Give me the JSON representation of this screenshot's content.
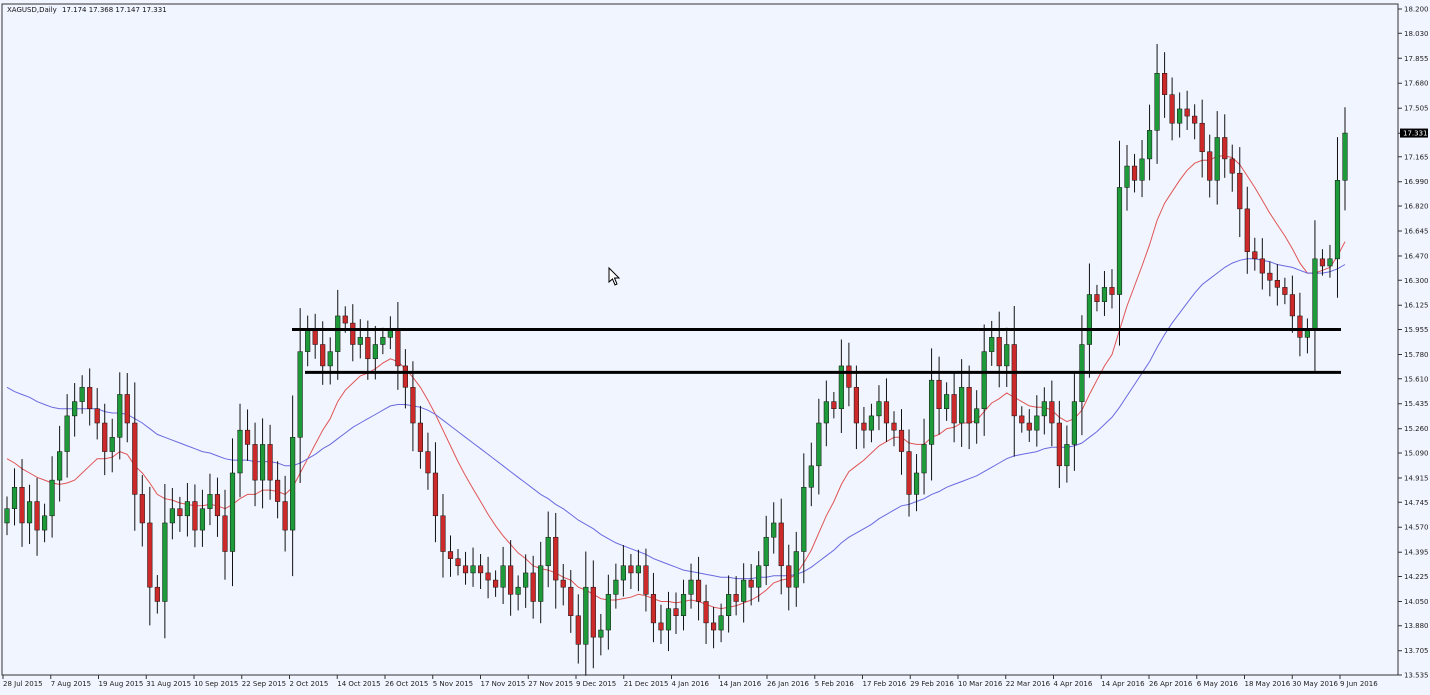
{
  "window": {
    "symbol": "XAGUSD,Daily",
    "ohlc_header": "17.174 17.368 17.147 17.331"
  },
  "colors": {
    "background": "#f1f5ff",
    "bull": "#1f9a3a",
    "bear": "#cc2a2a",
    "ma_fast": "#e05555",
    "ma_slow": "#6a6ae0",
    "support_lines": "#000000",
    "price_label_bg": "#000000"
  },
  "chart_data": {
    "type": "candlestick",
    "symbol": "XAGUSD",
    "timeframe": "Daily",
    "current_price": "17.331",
    "ylim": [
      13.535,
      18.2
    ],
    "y_ticks": [
      "18.200",
      "18.030",
      "17.855",
      "17.680",
      "17.505",
      "17.330",
      "17.165",
      "16.990",
      "16.820",
      "16.645",
      "16.470",
      "16.300",
      "16.125",
      "15.955",
      "15.780",
      "15.610",
      "15.435",
      "15.260",
      "15.090",
      "14.915",
      "14.745",
      "14.570",
      "14.395",
      "14.225",
      "14.050",
      "13.880",
      "13.705",
      "13.535"
    ],
    "x_ticks": [
      "28 Jul 2015",
      "7 Aug 2015",
      "19 Aug 2015",
      "31 Aug 2015",
      "10 Sep 2015",
      "22 Sep 2015",
      "2 Oct 2015",
      "14 Oct 2015",
      "26 Oct 2015",
      "5 Nov 2015",
      "17 Nov 2015",
      "27 Nov 2015",
      "9 Dec 2015",
      "21 Dec 2015",
      "4 Jan 2016",
      "14 Jan 2016",
      "26 Jan 2016",
      "5 Feb 2016",
      "17 Feb 2016",
      "29 Feb 2016",
      "10 Mar 2016",
      "22 Mar 2016",
      "4 Apr 2016",
      "14 Apr 2016",
      "26 Apr 2016",
      "6 May 2016",
      "18 May 2016",
      "30 May 2016",
      "9 Jun 2016"
    ],
    "closes": [
      14.7,
      14.85,
      14.6,
      14.75,
      14.55,
      14.65,
      14.9,
      15.1,
      15.35,
      15.45,
      15.55,
      15.4,
      15.3,
      15.1,
      15.2,
      15.5,
      15.3,
      14.8,
      14.6,
      14.15,
      14.05,
      14.6,
      14.7,
      14.65,
      14.75,
      14.55,
      14.7,
      14.8,
      14.65,
      14.4,
      14.95,
      15.25,
      15.15,
      14.9,
      15.15,
      14.9,
      14.75,
      14.55,
      15.2,
      15.8,
      15.95,
      15.85,
      15.7,
      15.8,
      16.05,
      16.0,
      15.85,
      15.9,
      15.75,
      15.85,
      15.9,
      15.95,
      15.7,
      15.55,
      15.3,
      15.1,
      14.95,
      14.65,
      14.4,
      14.35,
      14.3,
      14.25,
      14.3,
      14.25,
      14.2,
      14.15,
      14.3,
      14.1,
      14.15,
      14.25,
      14.05,
      14.3,
      14.5,
      14.2,
      14.15,
      13.95,
      13.75,
      14.15,
      13.8,
      13.85,
      14.1,
      14.2,
      14.3,
      14.25,
      14.3,
      14.1,
      13.9,
      13.85,
      14.0,
      13.95,
      14.1,
      14.2,
      14.05,
      13.9,
      13.85,
      13.95,
      14.1,
      14.05,
      14.2,
      14.15,
      14.3,
      14.5,
      14.6,
      14.3,
      14.15,
      14.4,
      14.85,
      15.0,
      15.3,
      15.45,
      15.4,
      15.7,
      15.55,
      15.3,
      15.25,
      15.35,
      15.45,
      15.3,
      15.25,
      15.1,
      14.8,
      14.95,
      15.15,
      15.6,
      15.4,
      15.5,
      15.3,
      15.55,
      15.3,
      15.4,
      15.8,
      15.9,
      15.7,
      15.85,
      15.35,
      15.3,
      15.25,
      15.35,
      15.45,
      15.3,
      15.0,
      15.15,
      15.45,
      15.85,
      16.2,
      16.15,
      16.25,
      16.2,
      16.95,
      17.1,
      17.0,
      17.15,
      17.35,
      17.75,
      17.6,
      17.4,
      17.5,
      17.45,
      17.4,
      17.2,
      17.0,
      17.3,
      17.15,
      17.05,
      16.8,
      16.5,
      16.45,
      16.35,
      16.3,
      16.25,
      16.2,
      16.05,
      15.9,
      15.95,
      16.45,
      16.4,
      16.45,
      17.0,
      17.331
    ],
    "moving_averages": [
      {
        "type": "MA-fast",
        "values": [
          15.05,
          15.02,
          14.98,
          14.95,
          14.92,
          14.9,
          14.88,
          14.87,
          14.88,
          14.9,
          14.95,
          15.0,
          15.05,
          15.05,
          15.06,
          15.1,
          15.08,
          15.0,
          14.95,
          14.88,
          14.8,
          14.77,
          14.76,
          14.74,
          14.73,
          14.72,
          14.72,
          14.73,
          14.72,
          14.7,
          14.73,
          14.77,
          14.8,
          14.8,
          14.83,
          14.83,
          14.82,
          14.8,
          14.85,
          14.95,
          15.05,
          15.15,
          15.25,
          15.33,
          15.45,
          15.53,
          15.58,
          15.63,
          15.65,
          15.68,
          15.72,
          15.75,
          15.73,
          15.68,
          15.62,
          15.55,
          15.46,
          15.36,
          15.25,
          15.14,
          15.03,
          14.93,
          14.84,
          14.75,
          14.66,
          14.58,
          14.51,
          14.45,
          14.39,
          14.35,
          14.3,
          14.28,
          14.27,
          14.25,
          14.22,
          14.2,
          14.15,
          14.13,
          14.1,
          14.07,
          14.06,
          14.06,
          14.07,
          14.08,
          14.1,
          14.09,
          14.07,
          14.05,
          14.05,
          14.04,
          14.05,
          14.06,
          14.05,
          14.03,
          14.01,
          14.0,
          14.01,
          14.02,
          14.04,
          14.06,
          14.09,
          14.13,
          14.18,
          14.2,
          14.21,
          14.24,
          14.32,
          14.41,
          14.53,
          14.65,
          14.75,
          14.87,
          14.96,
          15.0,
          15.04,
          15.09,
          15.14,
          15.17,
          15.2,
          15.2,
          15.16,
          15.15,
          15.15,
          15.2,
          15.22,
          15.26,
          15.27,
          15.3,
          15.3,
          15.32,
          15.38,
          15.44,
          15.47,
          15.51,
          15.48,
          15.45,
          15.42,
          15.41,
          15.41,
          15.39,
          15.34,
          15.31,
          15.33,
          15.39,
          15.5,
          15.6,
          15.7,
          15.78,
          15.95,
          16.12,
          16.26,
          16.4,
          16.55,
          16.72,
          16.84,
          16.92,
          17.0,
          17.07,
          17.12,
          17.14,
          17.14,
          17.17,
          17.17,
          17.16,
          17.11,
          17.03,
          16.95,
          16.86,
          16.77,
          16.69,
          16.61,
          16.52,
          16.42,
          16.35,
          16.35,
          16.37,
          16.39,
          16.47,
          16.57
        ]
      },
      {
        "type": "MA-slow",
        "values": [
          15.55,
          15.52,
          15.5,
          15.48,
          15.45,
          15.43,
          15.41,
          15.4,
          15.4,
          15.4,
          15.4,
          15.4,
          15.4,
          15.38,
          15.37,
          15.37,
          15.36,
          15.33,
          15.3,
          15.26,
          15.22,
          15.2,
          15.18,
          15.16,
          15.14,
          15.12,
          15.1,
          15.09,
          15.07,
          15.05,
          15.04,
          15.04,
          15.04,
          15.03,
          15.03,
          15.03,
          15.02,
          15.0,
          15.0,
          15.02,
          15.05,
          15.08,
          15.12,
          15.15,
          15.19,
          15.23,
          15.27,
          15.3,
          15.33,
          15.36,
          15.39,
          15.42,
          15.43,
          15.43,
          15.42,
          15.41,
          15.39,
          15.36,
          15.32,
          15.28,
          15.24,
          15.2,
          15.16,
          15.12,
          15.08,
          15.04,
          15.0,
          14.96,
          14.92,
          14.88,
          14.84,
          14.8,
          14.77,
          14.73,
          14.7,
          14.66,
          14.62,
          14.59,
          14.56,
          14.52,
          14.49,
          14.46,
          14.44,
          14.42,
          14.4,
          14.38,
          14.35,
          14.33,
          14.31,
          14.29,
          14.27,
          14.26,
          14.25,
          14.24,
          14.23,
          14.22,
          14.22,
          14.21,
          14.21,
          14.21,
          14.22,
          14.22,
          14.23,
          14.23,
          14.23,
          14.24,
          14.26,
          14.29,
          14.33,
          14.37,
          14.41,
          14.46,
          14.5,
          14.53,
          14.56,
          14.59,
          14.63,
          14.66,
          14.69,
          14.72,
          14.73,
          14.75,
          14.77,
          14.8,
          14.82,
          14.85,
          14.87,
          14.89,
          14.91,
          14.93,
          14.96,
          14.99,
          15.02,
          15.05,
          15.07,
          15.08,
          15.09,
          15.1,
          15.12,
          15.13,
          15.13,
          15.13,
          15.14,
          15.16,
          15.2,
          15.24,
          15.29,
          15.34,
          15.41,
          15.49,
          15.57,
          15.65,
          15.73,
          15.83,
          15.92,
          16.0,
          16.07,
          16.14,
          16.21,
          16.27,
          16.31,
          16.35,
          16.39,
          16.42,
          16.44,
          16.45,
          16.45,
          16.44,
          16.43,
          16.41,
          16.4,
          16.39,
          16.37,
          16.35,
          16.35,
          16.35,
          16.36,
          16.38,
          16.41
        ]
      }
    ],
    "horizontal_levels": [
      15.955,
      15.655
    ],
    "grid": false
  }
}
